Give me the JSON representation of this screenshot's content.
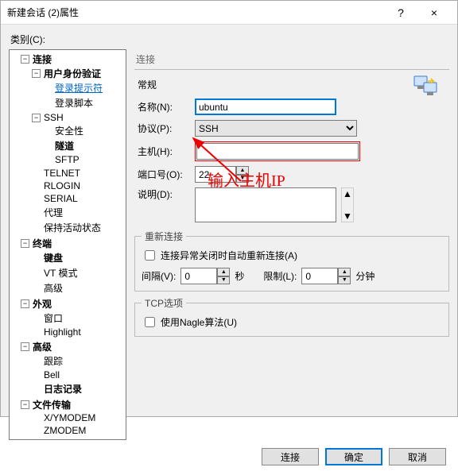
{
  "window": {
    "title": "新建会话 (2)属性",
    "help_icon": "?",
    "close_icon": "×"
  },
  "category_label": "类别(C):",
  "tree": {
    "connection": "连接",
    "user_auth": "用户身份验证",
    "login_prompt": "登录提示符",
    "login_script": "登录脚本",
    "ssh": "SSH",
    "security": "安全性",
    "tunnel": "隧道",
    "sftp": "SFTP",
    "telnet": "TELNET",
    "rlogin": "RLOGIN",
    "serial": "SERIAL",
    "proxy": "代理",
    "keepalive": "保持活动状态",
    "terminal": "终端",
    "keyboard": "键盘",
    "vtmode": "VT 模式",
    "advanced_term": "高级",
    "appearance": "外观",
    "window_item": "窗口",
    "highlight": "Highlight",
    "advanced": "高级",
    "trace": "跟踪",
    "bell": "Bell",
    "logging": "日志记录",
    "filetransfer": "文件传输",
    "xymodem": "X/YMODEM",
    "zmodem": "ZMODEM"
  },
  "content": {
    "section": "连接",
    "general": "常规",
    "name_label": "名称(N):",
    "name_value": "ubuntu",
    "protocol_label": "协议(P):",
    "protocol_value": "SSH",
    "host_label": "主机(H):",
    "host_value": "",
    "port_label": "端口号(O):",
    "port_value": "22",
    "desc_label": "说明(D):",
    "reconnect_group": "重新连接",
    "reconnect_chk": "连接异常关闭时自动重新连接(A)",
    "interval_label": "间隔(V):",
    "interval_value": "0",
    "sec_label": "秒",
    "limit_label": "限制(L):",
    "limit_value": "0",
    "min_label": "分钟",
    "tcp_group": "TCP选项",
    "nagle_chk": "使用Nagle算法(U)"
  },
  "annotation": "输入主机IP",
  "buttons": {
    "connect": "连接",
    "ok": "确定",
    "cancel": "取消"
  },
  "twist": {
    "minus": "−",
    "plus": "+"
  }
}
